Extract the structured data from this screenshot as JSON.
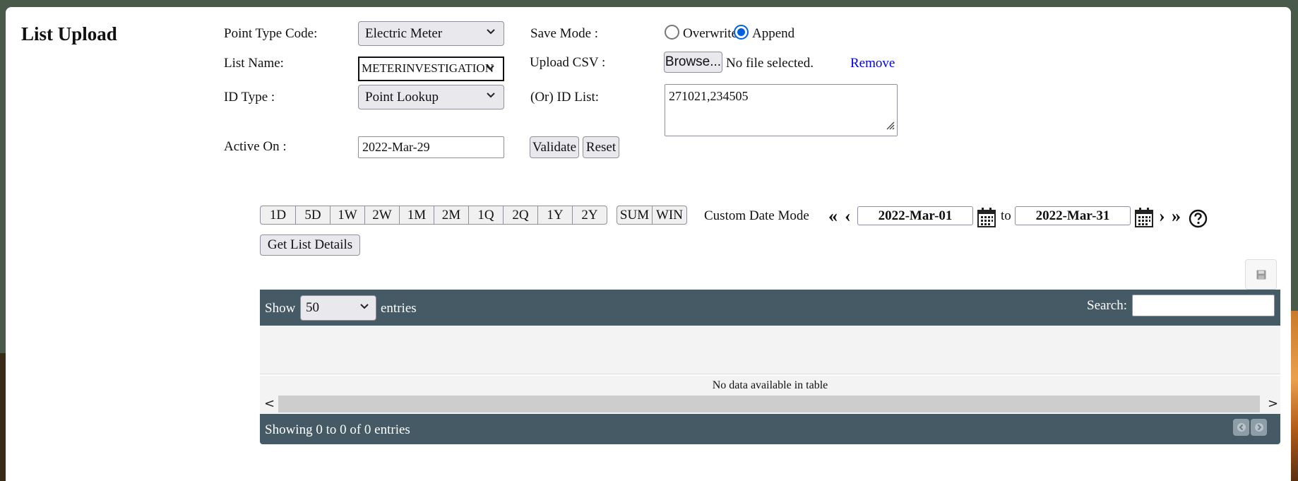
{
  "page": {
    "title": "List Upload"
  },
  "form": {
    "point_type_label": "Point Type Code:",
    "point_type_value": "Electric Meter",
    "list_name_label": "List Name:",
    "list_name_value": "METERINVESTIGATION",
    "id_type_label": "ID Type :",
    "id_type_value": "Point Lookup",
    "active_on_label": "Active On :",
    "active_on_value": "2022-Mar-29",
    "save_mode_label": "Save Mode :",
    "overwrite_label": "Overwrite",
    "append_label": "Append",
    "save_mode_selected": "Append",
    "upload_csv_label": "Upload CSV :",
    "browse_label": "Browse...",
    "no_file_text": "No file selected.",
    "remove_label": "Remove",
    "id_list_label": "(Or) ID List:",
    "id_list_value": "271021,234505",
    "validate_label": "Validate",
    "reset_label": "Reset"
  },
  "date_range": {
    "presets": [
      "1D",
      "5D",
      "1W",
      "2W",
      "1M",
      "2M",
      "1Q",
      "2Q",
      "1Y",
      "2Y"
    ],
    "modes": [
      "SUM",
      "WIN"
    ],
    "custom_mode_label": "Custom Date Mode",
    "first_label": "«",
    "prev_label": "‹",
    "start_date": "2022-Mar-01",
    "to_label": "to",
    "end_date": "2022-Mar-31",
    "next_label": "›",
    "last_label": "»"
  },
  "actions": {
    "get_list_details_label": "Get List Details"
  },
  "table": {
    "show_label": "Show",
    "page_length": "50",
    "entries_label": "entries",
    "search_label": "Search:",
    "search_value": "",
    "empty_text": "No data available in table",
    "info_text": "Showing 0 to 0 of 0 entries"
  },
  "icons": {
    "calendar": "calendar-icon",
    "help": "help-icon",
    "export": "save-icon",
    "chevron": "chevron-down-icon"
  },
  "colors": {
    "table_header": "#455a64",
    "radio_accent": "#0060df",
    "link": "#0000ee"
  }
}
